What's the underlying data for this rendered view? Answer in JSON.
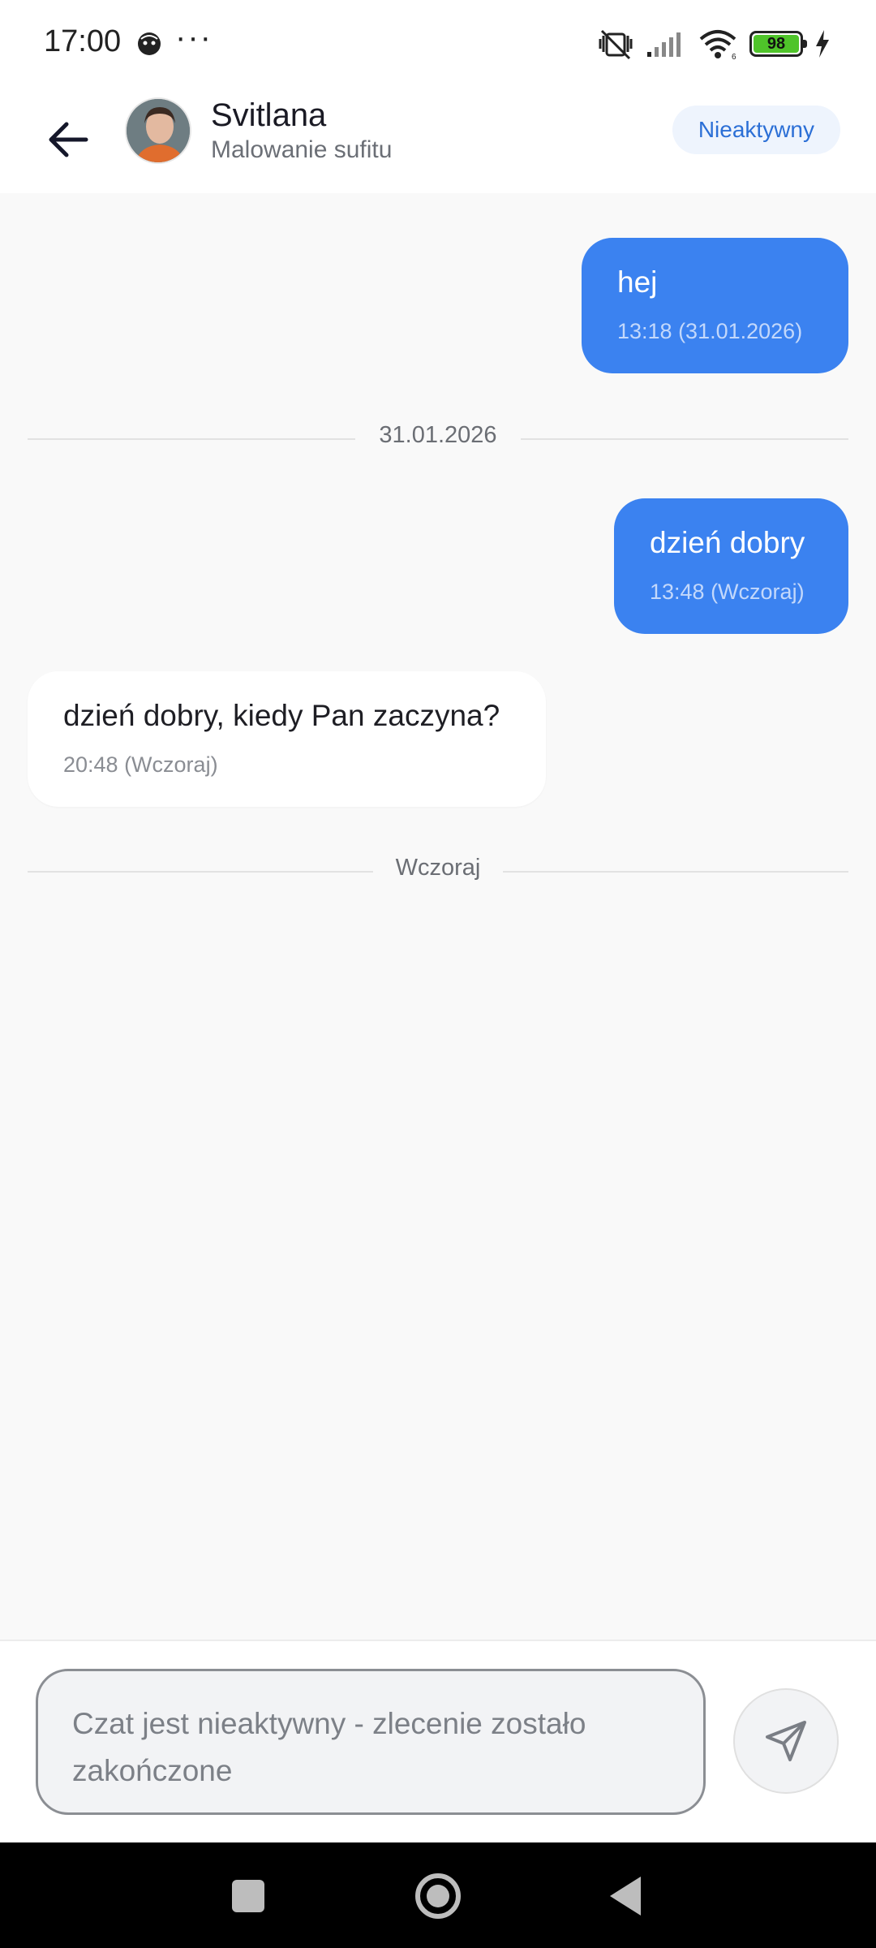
{
  "status_bar": {
    "time": "17:00",
    "dots": "···",
    "battery": "98",
    "icons": [
      "face-icon",
      "mute-vibrate-icon",
      "signal-icon",
      "wifi-icon",
      "battery-icon",
      "charging-bolt-icon"
    ]
  },
  "header": {
    "name": "Svitlana",
    "subtitle": "Malowanie sufitu",
    "status_label": "Nieaktywny"
  },
  "messages": [
    {
      "direction": "out",
      "text": "hej",
      "time": "13:18 (31.01.2026)"
    },
    {
      "direction": "out",
      "text": "dzień dobry",
      "time": "13:48 (Wczoraj)"
    },
    {
      "direction": "in",
      "text": "dzień dobry, kiedy Pan zaczyna?",
      "time": "20:48 (Wczoraj)"
    }
  ],
  "dividers": [
    "31.01.2026",
    "Wczoraj"
  ],
  "input": {
    "placeholder": "Czat jest nieaktywny - zlecenie zostało zakończone"
  },
  "colors": {
    "accent": "#3b82f0",
    "status_pill_text": "#2b6fd6",
    "battery": "#4fc42a"
  }
}
